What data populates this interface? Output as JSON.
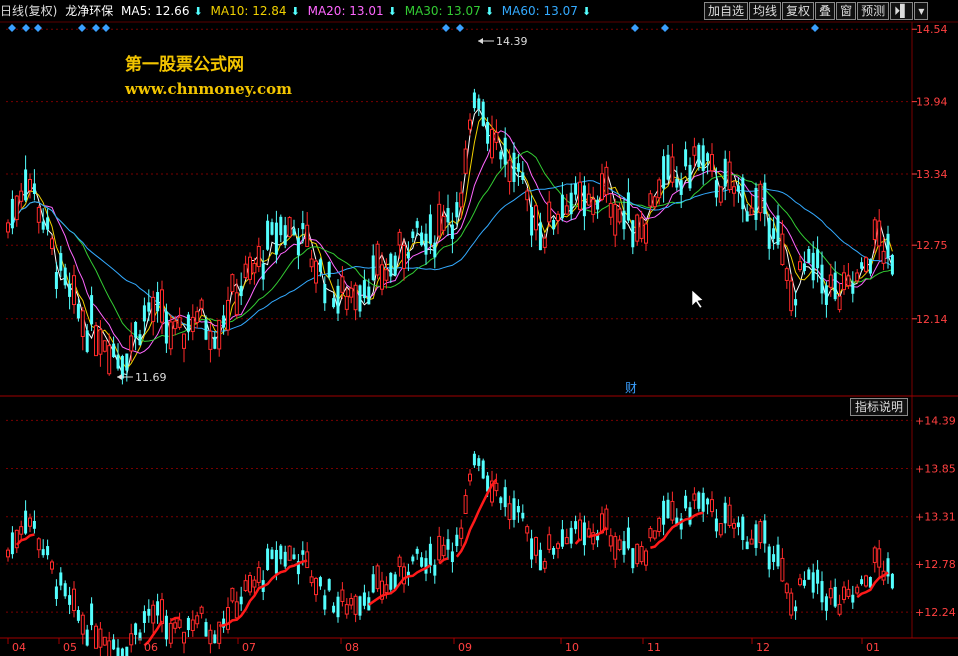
{
  "header": {
    "period": "日线(复权)",
    "stock_name": "龙净环保",
    "ma": [
      {
        "label": "MA5: 12.66",
        "color": "#ffffff"
      },
      {
        "label": "MA10: 12.84",
        "color": "#f0d000"
      },
      {
        "label": "MA20: 13.01",
        "color": "#ff66ff"
      },
      {
        "label": "MA30: 13.07",
        "color": "#33cc33"
      },
      {
        "label": "MA60: 13.07",
        "color": "#33aaff"
      }
    ],
    "down_arrow": "⬇"
  },
  "toolbar": {
    "buttons": [
      "加自选",
      "均线",
      "复权",
      "叠",
      "窗",
      "预测"
    ],
    "nav_icon": "⏵▌",
    "menu_icon": "▾"
  },
  "watermark": {
    "line1": "第一股票公式网",
    "line2": "www.chnmoney.com"
  },
  "price_axis": [
    "14.54",
    "13.94",
    "13.34",
    "12.75",
    "12.14"
  ],
  "indicator_axis": [
    "+14.39",
    "+13.85",
    "+13.31",
    "+12.78",
    "+12.24"
  ],
  "annotations": {
    "high": "14.39",
    "low": "11.69",
    "finance_marker": "财"
  },
  "indicator_button": "指标说明",
  "months": [
    "04",
    "05",
    "06",
    "07",
    "08",
    "09",
    "10",
    "11",
    "12",
    "01"
  ],
  "colors": {
    "up": "#ff2a2a",
    "down": "#54ffff",
    "grid": "#7a0000",
    "axis_text": "#ff4040",
    "marker": "#3aa0ff"
  },
  "chart_data": {
    "type": "candlestick",
    "price_range": [
      11.5,
      14.6
    ],
    "series_high": 14.39,
    "series_low": 11.69,
    "month_ticks": [
      "04",
      "05",
      "06",
      "07",
      "08",
      "09",
      "10",
      "11",
      "12",
      "01"
    ]
  }
}
